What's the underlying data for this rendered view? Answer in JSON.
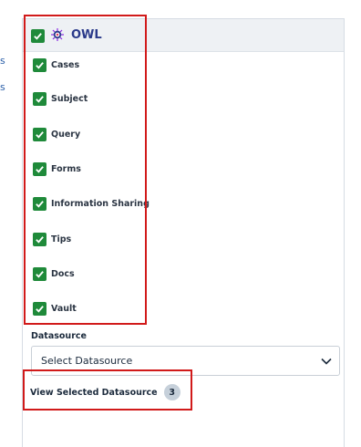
{
  "left_fragments": [
    "s",
    "s"
  ],
  "owl": {
    "title": "OWL",
    "checked": true
  },
  "items": [
    {
      "label": "Cases",
      "checked": true
    },
    {
      "label": "Subject",
      "checked": true
    },
    {
      "label": "Query",
      "checked": true
    },
    {
      "label": "Forms",
      "checked": true
    },
    {
      "label": "Information Sharing",
      "checked": true
    },
    {
      "label": "Tips",
      "checked": true
    },
    {
      "label": "Docs",
      "checked": true
    },
    {
      "label": "Vault",
      "checked": true
    }
  ],
  "datasource": {
    "label": "Datasource",
    "selected_value": "Select Datasource"
  },
  "view_selected": {
    "label": "View Selected Datasource",
    "count": "3"
  },
  "colors": {
    "checkbox": "#1f8a3a",
    "highlight": "#d11a1a",
    "title": "#2a3a8a"
  }
}
